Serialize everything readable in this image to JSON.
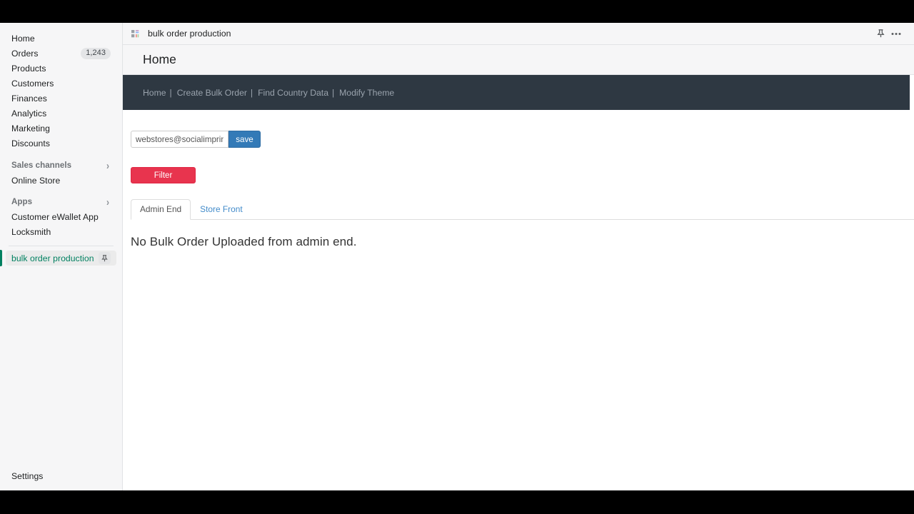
{
  "sidebar": {
    "primary_items": [
      {
        "label": "Home",
        "badge": null
      },
      {
        "label": "Orders",
        "badge": "1,243"
      },
      {
        "label": "Products",
        "badge": null
      },
      {
        "label": "Customers",
        "badge": null
      },
      {
        "label": "Finances",
        "badge": null
      },
      {
        "label": "Analytics",
        "badge": null
      },
      {
        "label": "Marketing",
        "badge": null
      },
      {
        "label": "Discounts",
        "badge": null
      }
    ],
    "sales_channels": {
      "heading": "Sales channels",
      "items": [
        {
          "label": "Online Store"
        }
      ]
    },
    "apps": {
      "heading": "Apps",
      "items": [
        {
          "label": "Customer eWallet App"
        },
        {
          "label": "Locksmith"
        }
      ]
    },
    "active_app": {
      "label": "bulk order production",
      "pin_icon": "pin-icon"
    },
    "footer": {
      "label": "Settings"
    },
    "accent_color": "#008060"
  },
  "topbar": {
    "app_icon": "apps-grid-icon",
    "title": "bulk order production",
    "pin_icon": "pin-icon",
    "more_icon": "ellipsis-horizontal-icon"
  },
  "page": {
    "title": "Home"
  },
  "app_nav": {
    "links": [
      {
        "label": "Home",
        "separator": "|"
      },
      {
        "label": "Create Bulk Order",
        "separator": "|"
      },
      {
        "label": "Find Country Data",
        "separator": "|"
      },
      {
        "label": "Modify Theme",
        "separator": ""
      }
    ],
    "background": "#2e3842"
  },
  "form": {
    "email_value": "webstores@socialimprints.com",
    "email_placeholder": "",
    "save_label": "save",
    "save_color": "#337ab7"
  },
  "filter": {
    "label": "Filter",
    "color": "#e8344e"
  },
  "tabs": [
    {
      "label": "Admin End",
      "active": true
    },
    {
      "label": "Store Front",
      "active": false
    }
  ],
  "content": {
    "empty_message": "No Bulk Order Uploaded from admin end."
  }
}
